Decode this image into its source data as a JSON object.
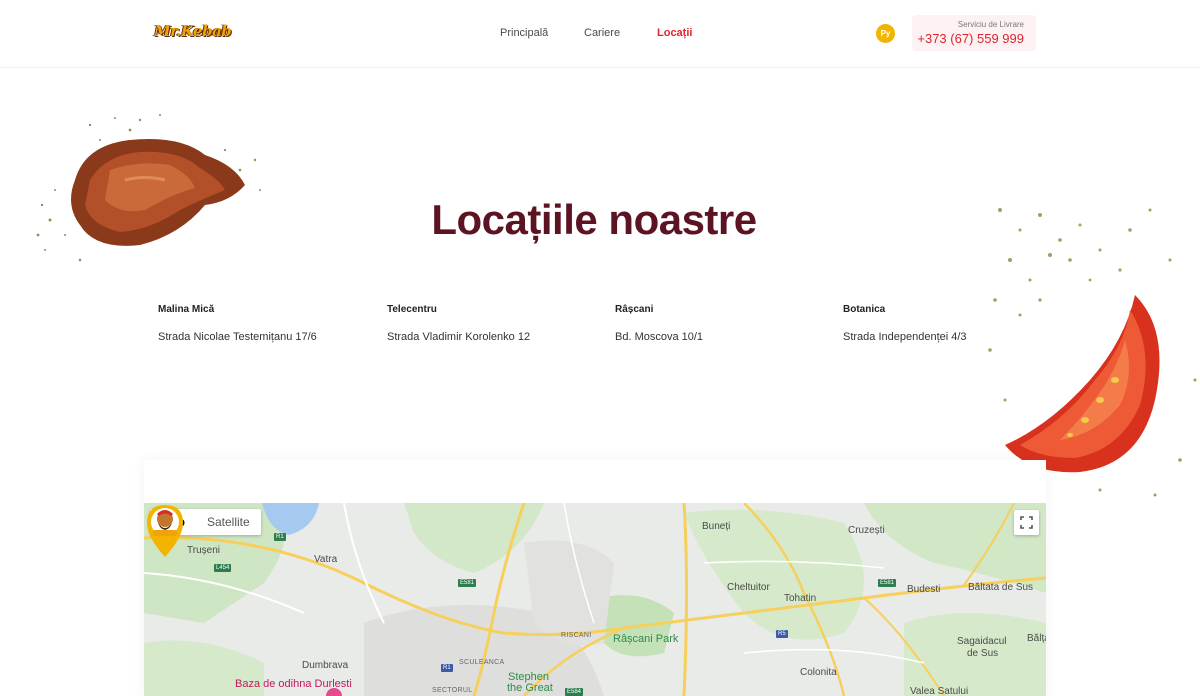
{
  "header": {
    "logo_text": "Mr.Kebab",
    "nav": [
      {
        "label": "Principală"
      },
      {
        "label": "Cariere"
      },
      {
        "label": "Locații"
      }
    ],
    "language": "Ру",
    "delivery_label": "Serviciu de Livrare",
    "phone": "+373 (67) 559 999"
  },
  "colors": {
    "accent": "#e0242b",
    "title": "#5c1322",
    "brand_yellow": "#f3b400"
  },
  "page": {
    "title": "Locațiile noastre"
  },
  "locations": [
    {
      "name": "Malina Mică",
      "address": "Strada Nicolae Testemițanu 17/6"
    },
    {
      "name": "Telecentru",
      "address": "Strada Vladimir Korolenko 12"
    },
    {
      "name": "Râșcani",
      "address": "Bd. Moscova 10/1"
    },
    {
      "name": "Botanica",
      "address": "Strada Independenței 4/3"
    }
  ],
  "map": {
    "type_options": [
      "Map",
      "Satellite"
    ],
    "selected_type": "Map",
    "fullscreen_icon": "fullscreen-icon",
    "labels": {
      "truseni": "Trușeni",
      "vatra": "Vatra",
      "buneti": "Buneți",
      "cruzesti": "Cruzești",
      "cheltuitor": "Cheltuitor",
      "tohatin": "Tohatin",
      "budesti": "Budesti",
      "baltata_sus": "Băltata de Sus",
      "baltata": "Bălța",
      "rascani_park": "Râșcani Park",
      "rascani": "RISCANI",
      "dumbrava": "Dumbrava",
      "sculeanca": "SCULEANCA",
      "sagaidacul": "Sagaidacul",
      "de_sus": "de Sus",
      "colonita": "Colonita",
      "stephen": "Stephen",
      "the_great": "the Great",
      "baza_odihna": "Baza de odihna Durlesti",
      "sectorul": "SECTORUL",
      "valea_satului": "Valea Satului"
    },
    "shields": {
      "r1a": "R1",
      "l454": "L454",
      "e581a": "E581",
      "e581b": "E581",
      "r5": "R5",
      "r1b": "R1",
      "e584": "E584"
    }
  }
}
